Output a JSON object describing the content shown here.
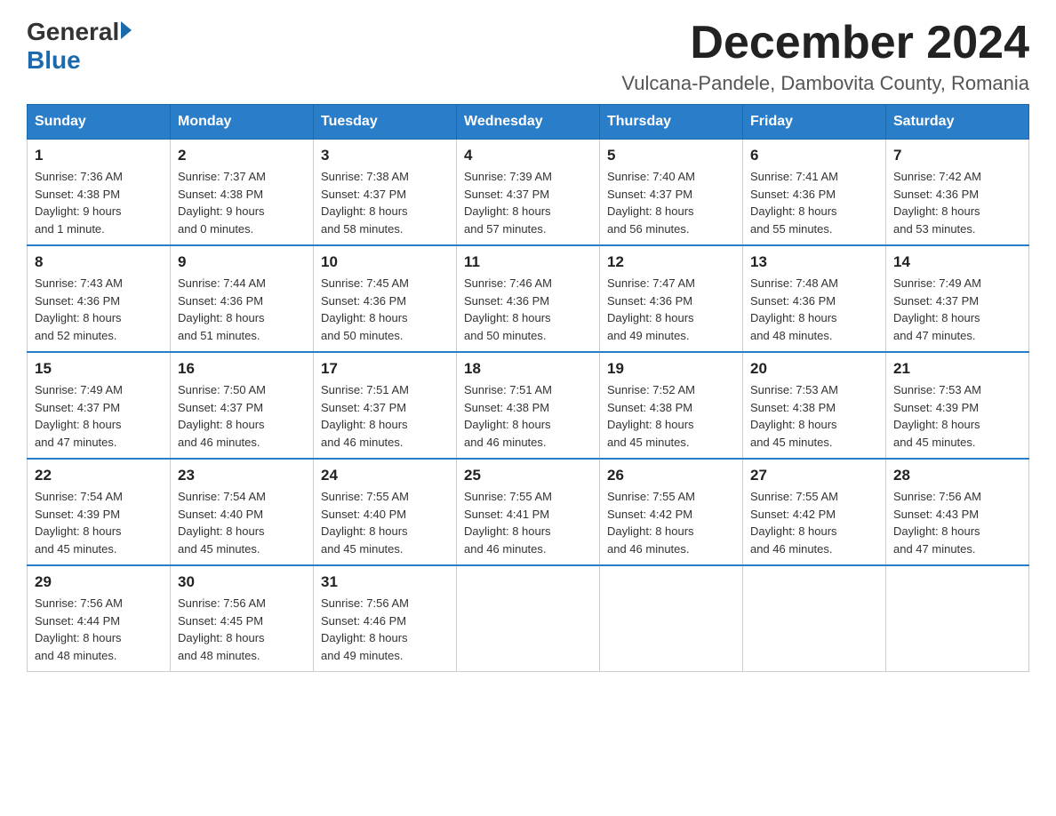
{
  "header": {
    "logo_general": "General",
    "logo_blue": "Blue",
    "month_title": "December 2024",
    "location": "Vulcana-Pandele, Dambovita County, Romania"
  },
  "days_of_week": [
    "Sunday",
    "Monday",
    "Tuesday",
    "Wednesday",
    "Thursday",
    "Friday",
    "Saturday"
  ],
  "weeks": [
    [
      {
        "day": "1",
        "info": "Sunrise: 7:36 AM\nSunset: 4:38 PM\nDaylight: 9 hours\nand 1 minute."
      },
      {
        "day": "2",
        "info": "Sunrise: 7:37 AM\nSunset: 4:38 PM\nDaylight: 9 hours\nand 0 minutes."
      },
      {
        "day": "3",
        "info": "Sunrise: 7:38 AM\nSunset: 4:37 PM\nDaylight: 8 hours\nand 58 minutes."
      },
      {
        "day": "4",
        "info": "Sunrise: 7:39 AM\nSunset: 4:37 PM\nDaylight: 8 hours\nand 57 minutes."
      },
      {
        "day": "5",
        "info": "Sunrise: 7:40 AM\nSunset: 4:37 PM\nDaylight: 8 hours\nand 56 minutes."
      },
      {
        "day": "6",
        "info": "Sunrise: 7:41 AM\nSunset: 4:36 PM\nDaylight: 8 hours\nand 55 minutes."
      },
      {
        "day": "7",
        "info": "Sunrise: 7:42 AM\nSunset: 4:36 PM\nDaylight: 8 hours\nand 53 minutes."
      }
    ],
    [
      {
        "day": "8",
        "info": "Sunrise: 7:43 AM\nSunset: 4:36 PM\nDaylight: 8 hours\nand 52 minutes."
      },
      {
        "day": "9",
        "info": "Sunrise: 7:44 AM\nSunset: 4:36 PM\nDaylight: 8 hours\nand 51 minutes."
      },
      {
        "day": "10",
        "info": "Sunrise: 7:45 AM\nSunset: 4:36 PM\nDaylight: 8 hours\nand 50 minutes."
      },
      {
        "day": "11",
        "info": "Sunrise: 7:46 AM\nSunset: 4:36 PM\nDaylight: 8 hours\nand 50 minutes."
      },
      {
        "day": "12",
        "info": "Sunrise: 7:47 AM\nSunset: 4:36 PM\nDaylight: 8 hours\nand 49 minutes."
      },
      {
        "day": "13",
        "info": "Sunrise: 7:48 AM\nSunset: 4:36 PM\nDaylight: 8 hours\nand 48 minutes."
      },
      {
        "day": "14",
        "info": "Sunrise: 7:49 AM\nSunset: 4:37 PM\nDaylight: 8 hours\nand 47 minutes."
      }
    ],
    [
      {
        "day": "15",
        "info": "Sunrise: 7:49 AM\nSunset: 4:37 PM\nDaylight: 8 hours\nand 47 minutes."
      },
      {
        "day": "16",
        "info": "Sunrise: 7:50 AM\nSunset: 4:37 PM\nDaylight: 8 hours\nand 46 minutes."
      },
      {
        "day": "17",
        "info": "Sunrise: 7:51 AM\nSunset: 4:37 PM\nDaylight: 8 hours\nand 46 minutes."
      },
      {
        "day": "18",
        "info": "Sunrise: 7:51 AM\nSunset: 4:38 PM\nDaylight: 8 hours\nand 46 minutes."
      },
      {
        "day": "19",
        "info": "Sunrise: 7:52 AM\nSunset: 4:38 PM\nDaylight: 8 hours\nand 45 minutes."
      },
      {
        "day": "20",
        "info": "Sunrise: 7:53 AM\nSunset: 4:38 PM\nDaylight: 8 hours\nand 45 minutes."
      },
      {
        "day": "21",
        "info": "Sunrise: 7:53 AM\nSunset: 4:39 PM\nDaylight: 8 hours\nand 45 minutes."
      }
    ],
    [
      {
        "day": "22",
        "info": "Sunrise: 7:54 AM\nSunset: 4:39 PM\nDaylight: 8 hours\nand 45 minutes."
      },
      {
        "day": "23",
        "info": "Sunrise: 7:54 AM\nSunset: 4:40 PM\nDaylight: 8 hours\nand 45 minutes."
      },
      {
        "day": "24",
        "info": "Sunrise: 7:55 AM\nSunset: 4:40 PM\nDaylight: 8 hours\nand 45 minutes."
      },
      {
        "day": "25",
        "info": "Sunrise: 7:55 AM\nSunset: 4:41 PM\nDaylight: 8 hours\nand 46 minutes."
      },
      {
        "day": "26",
        "info": "Sunrise: 7:55 AM\nSunset: 4:42 PM\nDaylight: 8 hours\nand 46 minutes."
      },
      {
        "day": "27",
        "info": "Sunrise: 7:55 AM\nSunset: 4:42 PM\nDaylight: 8 hours\nand 46 minutes."
      },
      {
        "day": "28",
        "info": "Sunrise: 7:56 AM\nSunset: 4:43 PM\nDaylight: 8 hours\nand 47 minutes."
      }
    ],
    [
      {
        "day": "29",
        "info": "Sunrise: 7:56 AM\nSunset: 4:44 PM\nDaylight: 8 hours\nand 48 minutes."
      },
      {
        "day": "30",
        "info": "Sunrise: 7:56 AM\nSunset: 4:45 PM\nDaylight: 8 hours\nand 48 minutes."
      },
      {
        "day": "31",
        "info": "Sunrise: 7:56 AM\nSunset: 4:46 PM\nDaylight: 8 hours\nand 49 minutes."
      },
      {
        "day": "",
        "info": ""
      },
      {
        "day": "",
        "info": ""
      },
      {
        "day": "",
        "info": ""
      },
      {
        "day": "",
        "info": ""
      }
    ]
  ]
}
